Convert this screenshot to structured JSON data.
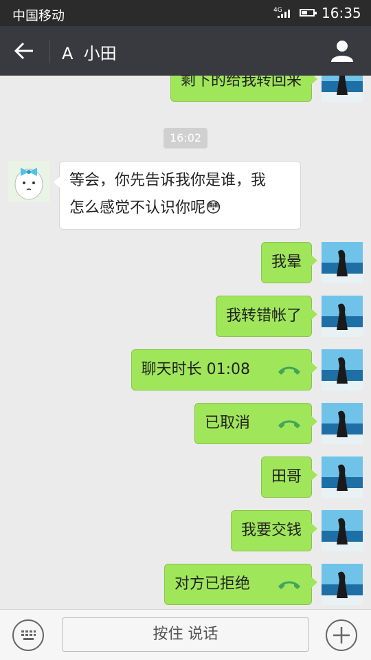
{
  "status_bar": {
    "carrier": "中国移动",
    "network": "4G",
    "time": "16:35",
    "battery_level": 0.5
  },
  "header": {
    "title": "A  小田",
    "back_icon": "arrow-left-icon",
    "profile_icon": "person-icon"
  },
  "timestamp": "16:02",
  "messages": [
    {
      "side": "me",
      "text": "剩下的给我转回来"
    },
    {
      "side": "other",
      "text_line1": "等会，你先告诉我你是谁，我",
      "text_line2": "怎么感觉不认识你呢",
      "emoji": "😳"
    },
    {
      "side": "me",
      "text": "我晕"
    },
    {
      "side": "me",
      "text": "我转错帐了"
    },
    {
      "side": "me",
      "text": "聊天时长 01:08",
      "icon": "phone-icon"
    },
    {
      "side": "me",
      "text": "已取消",
      "icon": "phone-icon"
    },
    {
      "side": "me",
      "text": "田哥"
    },
    {
      "side": "me",
      "text": "我要交钱"
    },
    {
      "side": "me",
      "text": "对方已拒绝",
      "icon": "phone-icon"
    }
  ],
  "input_bar": {
    "hold_to_talk": "按住 说话",
    "keyboard_icon": "keyboard-icon",
    "plus_icon": "plus-icon"
  },
  "colors": {
    "header_bg": "#393a3f",
    "my_bubble": "#a0e65a",
    "call_icon": "#3fa65a"
  }
}
